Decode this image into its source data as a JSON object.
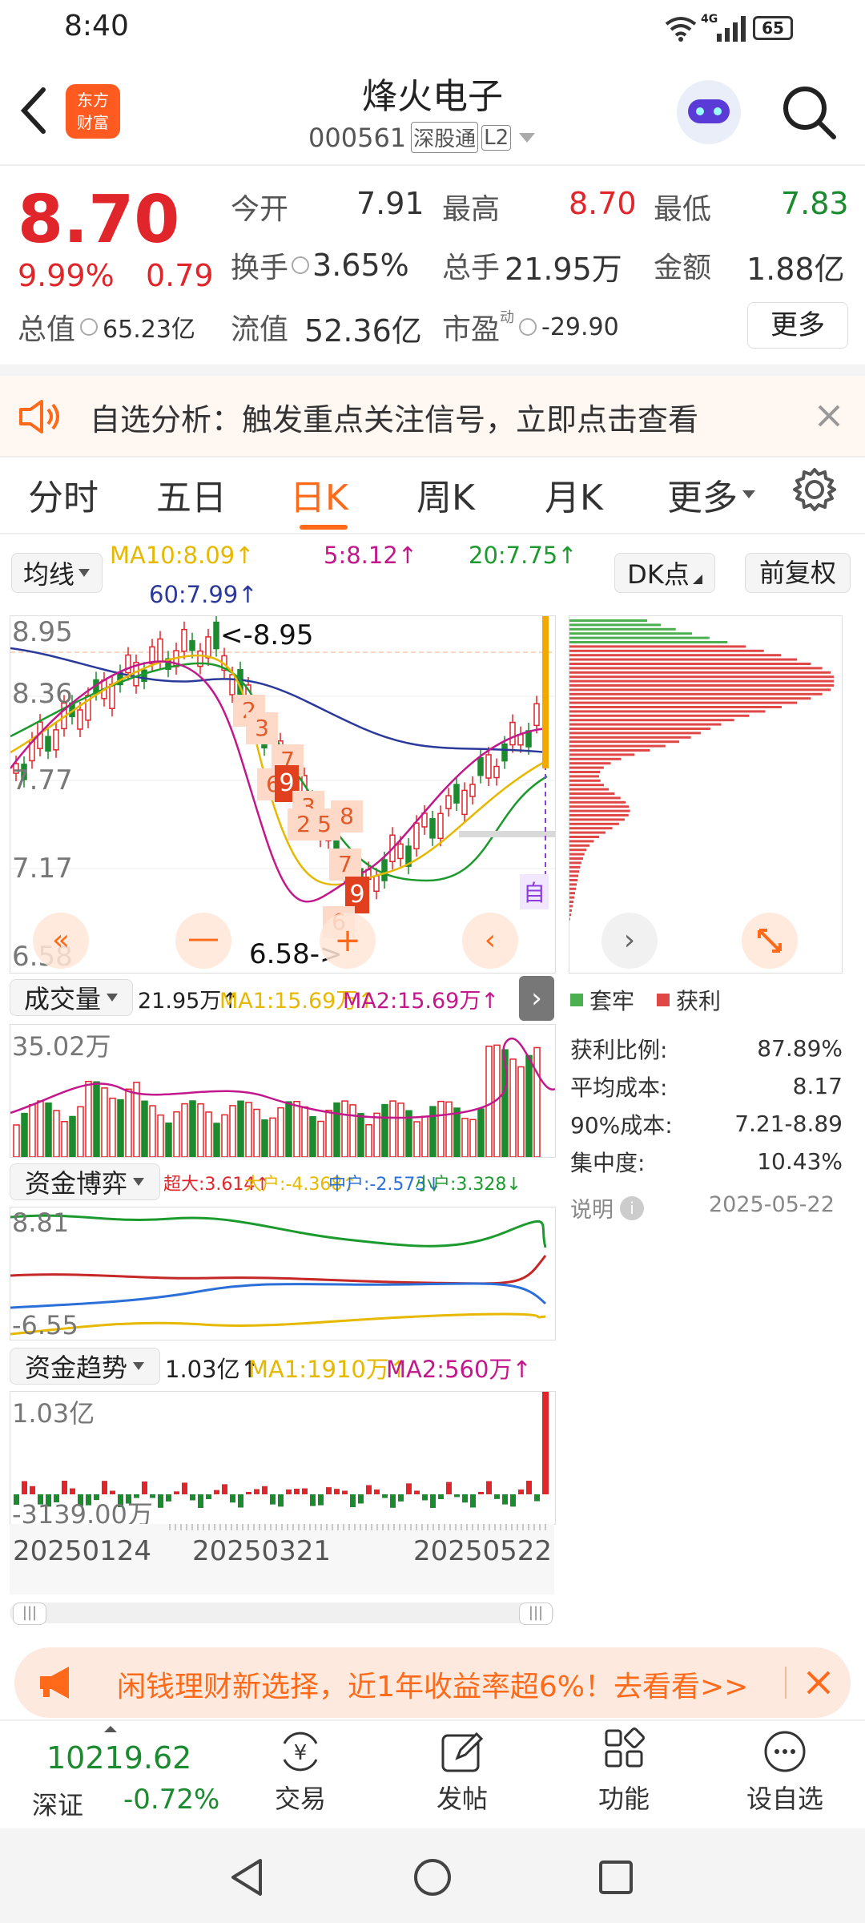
{
  "status_bar": {
    "time": "8:40",
    "battery": "65",
    "network": "4G"
  },
  "header": {
    "logo_text_1": "东方",
    "logo_text_2": "财富",
    "stock_name": "烽火电子",
    "stock_code": "000561",
    "tag_1": "深股通",
    "tag_2": "L2"
  },
  "quote": {
    "price": "8.70",
    "change_pct": "9.99%",
    "change_amt": "0.79",
    "open_label": "今开",
    "open": "7.91",
    "high_label": "最高",
    "high": "8.70",
    "low_label": "最低",
    "low": "7.83",
    "turnover_label": "换手",
    "turnover": "3.65%",
    "volume_label": "总手",
    "volume": "21.95万",
    "amount_label": "金额",
    "amount": "1.88亿",
    "mktcap_label": "总值",
    "mktcap": "65.23亿",
    "float_label": "流值",
    "float": "52.36亿",
    "pe_label": "市盈",
    "pe_sup": "动",
    "pe": "-29.90",
    "more": "更多"
  },
  "banner": {
    "text": "自选分析：触发重点关注信号，立即点击查看"
  },
  "tabs": [
    "分时",
    "五日",
    "日K",
    "周K",
    "月K",
    "更多"
  ],
  "active_tab": "日K",
  "kline": {
    "ma_select": "均线",
    "ma10": "MA10:8.09↑",
    "ma5": "5:8.12↑",
    "ma20": "20:7.75↑",
    "ma60": "60:7.99↑",
    "dk_button": "DK点",
    "adjust_button": "前复权",
    "y_labels": [
      "8.95",
      "8.36",
      "7.77",
      "7.17",
      "6.58"
    ],
    "high_marker": "<-8.95",
    "low_marker": "6.58->",
    "self_tag": "自"
  },
  "chip": {
    "legend_trapped": "套牢",
    "legend_profit": "获利",
    "rows": [
      {
        "label": "获利比例:",
        "value": "87.89%"
      },
      {
        "label": "平均成本:",
        "value": "8.17"
      },
      {
        "label": "90%成本:",
        "value": "7.21-8.89"
      },
      {
        "label": "集中度:",
        "value": "10.43%"
      }
    ],
    "note_label": "说明",
    "date": "2025-05-22"
  },
  "volume": {
    "select": "成交量",
    "value": "21.95万↑",
    "ma1": "MA1:15.69万↑",
    "ma2": "MA2:15.69万↑",
    "y_label": "35.02万"
  },
  "fund_game": {
    "select": "资金博弈",
    "super": "超大:3.614↑",
    "large": "大户:-4.368↑",
    "mid": "中户:-2.573↓",
    "small": "小户:3.328↓",
    "y_top": "8.81",
    "y_bottom": "-6.55"
  },
  "fund_trend": {
    "select": "资金趋势",
    "value": "1.03亿↑",
    "ma1": "MA1:1910万↑",
    "ma2": "MA2:560万↑",
    "y_top": "1.03亿",
    "y_bottom": "-3139.00万"
  },
  "dates": [
    "20250124",
    "20250321",
    "20250522"
  ],
  "promo": {
    "text": "闲钱理财新选择，近1年收益率超6%！去看看>>"
  },
  "bottom_nav": {
    "index_value": "10219.62",
    "index_name": "深证",
    "index_change": "-0.72%",
    "items": [
      "交易",
      "发帖",
      "功能",
      "设自选"
    ]
  },
  "colors": {
    "up": "#e0252b",
    "down": "#1c8a2e",
    "accent": "#ff6a1a",
    "ma5": "#c2188c",
    "ma10": "#e6b800",
    "ma20": "#1c9a2e",
    "ma60": "#2b3a9a"
  }
}
